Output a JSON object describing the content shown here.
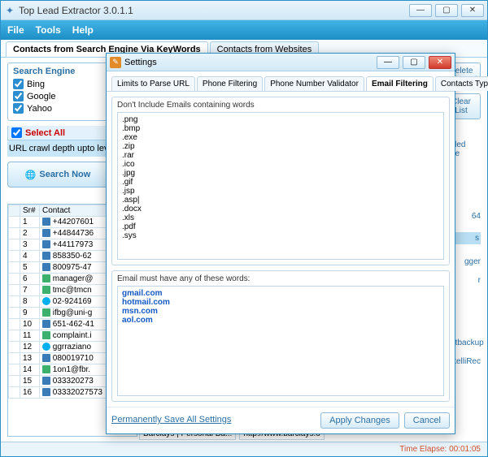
{
  "header": {
    "title": "Top Lead Extractor 3.0.1.1",
    "menu": {
      "file": "File",
      "tools": "Tools",
      "help": "Help"
    }
  },
  "main_tabs": {
    "t1": "Contacts from Search Engine Via KeyWords",
    "t2": "Contacts from Websites"
  },
  "search_panel": {
    "title": "Search Engine",
    "bing": "Bing",
    "google": "Google",
    "yahoo": "Yahoo"
  },
  "select_all": "Select All",
  "crawl_label": "URL crawl depth upto levels:",
  "buttons": {
    "search_now": "Search Now"
  },
  "table": {
    "h1": "Sr#",
    "h2": "Contact",
    "rows": [
      {
        "n": "1",
        "t": "phone",
        "v": "+44207601"
      },
      {
        "n": "2",
        "t": "phone",
        "v": "+44844736"
      },
      {
        "n": "3",
        "t": "phone",
        "v": "+44117973"
      },
      {
        "n": "4",
        "t": "phone",
        "v": "858350-62"
      },
      {
        "n": "5",
        "t": "phone",
        "v": "800975-47"
      },
      {
        "n": "6",
        "t": "mail",
        "v": "manager@"
      },
      {
        "n": "7",
        "t": "mail",
        "v": "tmc@tmcn"
      },
      {
        "n": "8",
        "t": "skype",
        "v": "02-924169"
      },
      {
        "n": "9",
        "t": "mail",
        "v": "ifbg@uni-g"
      },
      {
        "n": "10",
        "t": "phone",
        "v": "651-462-41"
      },
      {
        "n": "11",
        "t": "mail",
        "v": "complaint.i"
      },
      {
        "n": "12",
        "t": "skype",
        "v": "ggrraziano"
      },
      {
        "n": "13",
        "t": "phone",
        "v": "080019710"
      },
      {
        "n": "14",
        "t": "mail",
        "v": "1on1@fbr."
      },
      {
        "n": "15",
        "t": "phone",
        "v": "033320273"
      },
      {
        "n": "16",
        "t": "phone",
        "v": "03332027573"
      }
    ]
  },
  "right": {
    "delete": "Delete Selected",
    "clear": "Clear List",
    "crawled": "rawled page",
    "n64": "64",
    "s": "s",
    "logger": "gger",
    "r": "r",
    "fastbackup": "Fastbackup",
    "intellirec": "- IntelliRec"
  },
  "footer": {
    "cell1": "Barclays | Personal Ba...",
    "cell2": "http://www.barclays.o",
    "time_label": "Time Elapse: ",
    "time": "00:01:05"
  },
  "dialog": {
    "title": "Settings",
    "tabs": {
      "t1": "Limits to Parse URL",
      "t2": "Phone Filtering",
      "t3": "Phone Number Validator",
      "t4": "Email Filtering",
      "t5": "Contacts Types"
    },
    "f1_title": "Don't Include Emails containing words",
    "f1_text": ".png\n.bmp\n.exe\n.zip\n.rar\n.ico\n.jpg\n.gif\n.jsp\n.asp|\n.docx\n.xls\n.pdf\n.sys",
    "f2_title": "Email must have any of these words:",
    "f2_text": "gmail.com\nhotmail.com\nmsn.com\naol.com",
    "btn_save": "Permanently Save All Settings",
    "btn_apply": "Apply Changes",
    "btn_cancel": "Cancel"
  }
}
